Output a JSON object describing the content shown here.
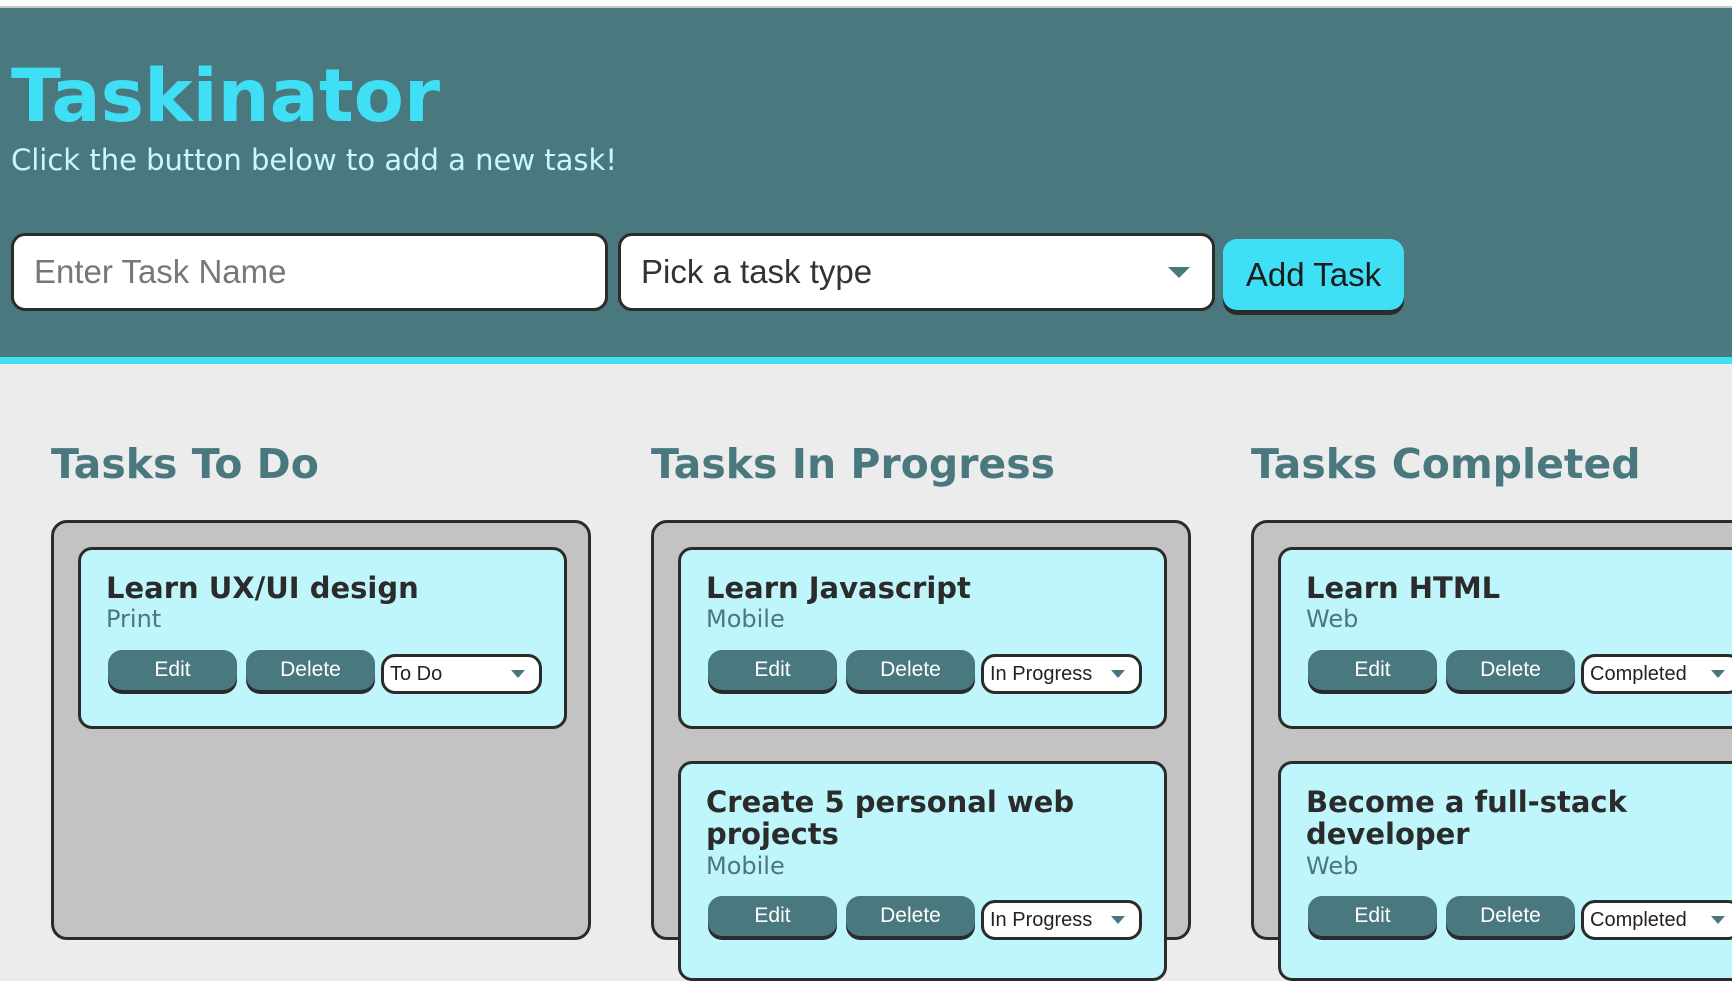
{
  "header": {
    "title": "Taskinator",
    "subtitle": "Click the button below to add a new task!",
    "task_input_placeholder": "Enter Task Name",
    "task_type_select": "Pick a task type",
    "add_button": "Add Task"
  },
  "columns": [
    {
      "title": "Tasks To Do",
      "tasks": [
        {
          "name": "Learn UX/UI design",
          "type": "Print",
          "status": "To Do"
        }
      ]
    },
    {
      "title": "Tasks In Progress",
      "tasks": [
        {
          "name": "Learn Javascript",
          "type": "Mobile",
          "status": "In Progress"
        },
        {
          "name": "Create 5 personal web projects",
          "type": "Mobile",
          "status": "In Progress"
        }
      ]
    },
    {
      "title": "Tasks Completed",
      "tasks": [
        {
          "name": "Learn HTML",
          "type": "Web",
          "status": "Completed"
        },
        {
          "name": "Become a full-stack developer",
          "type": "Web",
          "status": "Completed"
        }
      ]
    }
  ],
  "labels": {
    "edit": "Edit",
    "delete": "Delete"
  },
  "colors": {
    "header_bg": "#49787f",
    "accent": "#3fe0f6",
    "card_bg": "#bff6fb",
    "list_bg": "#c3c3c3",
    "page_bg": "#ececec"
  }
}
